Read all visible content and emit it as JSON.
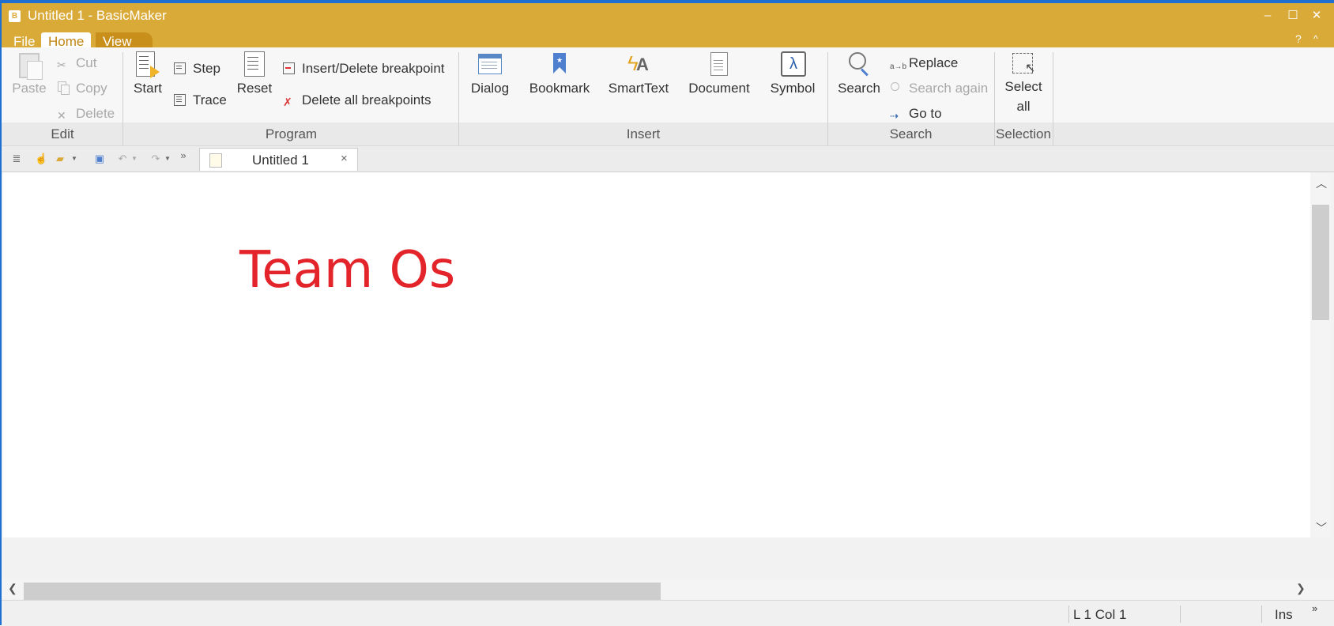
{
  "window": {
    "title": "Untitled 1 - BasicMaker",
    "app_icon": "B",
    "controls": {
      "minimize": "–",
      "maximize": "☐",
      "close": "✕"
    }
  },
  "menu": {
    "tabs": [
      "File",
      "Home",
      "View"
    ],
    "active": "Home",
    "help": "?",
    "collapse": "^"
  },
  "ribbon": {
    "edit": {
      "label": "Edit",
      "paste": "Paste",
      "cut": "Cut",
      "copy": "Copy",
      "delete": "Delete"
    },
    "program": {
      "label": "Program",
      "start": "Start",
      "step": "Step",
      "trace": "Trace",
      "reset": "Reset",
      "insert_delete_breakpoint": "Insert/Delete breakpoint",
      "delete_all_breakpoints": "Delete all breakpoints"
    },
    "insert": {
      "label": "Insert",
      "dialog": "Dialog",
      "bookmark": "Bookmark",
      "smarttext": "SmartText",
      "document": "Document",
      "symbol": "Symbol"
    },
    "search": {
      "label": "Search",
      "search": "Search",
      "replace": "Replace",
      "search_again": "Search again",
      "go_to": "Go to"
    },
    "selection": {
      "label": "Selection",
      "select_all_line1": "Select",
      "select_all_line2": "all"
    }
  },
  "document_tab": {
    "label": "Untitled 1",
    "close": "×"
  },
  "editor": {
    "content": "Team Os",
    "text_color": "#e3252b"
  },
  "status": {
    "position": "L 1 Col 1",
    "mode": "Ins",
    "more": "»"
  },
  "colors": {
    "titlebar": "#d9aa38",
    "accent": "#c08412"
  }
}
